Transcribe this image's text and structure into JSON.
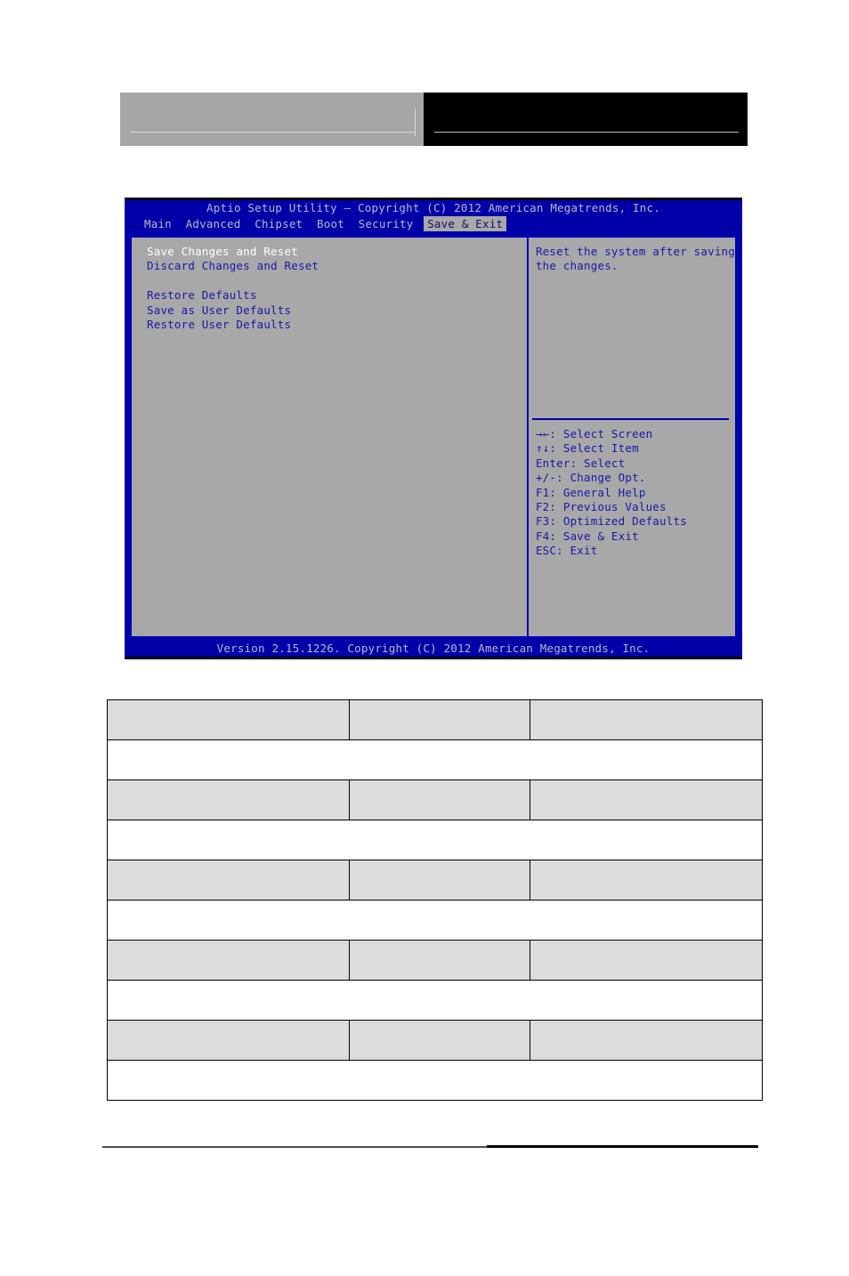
{
  "page": {
    "header_banner": {
      "left_block_color": "#a6a6a6",
      "right_block_color": "#000000"
    }
  },
  "bios": {
    "title": "Aptio Setup Utility – Copyright (C) 2012 American Megatrends, Inc.",
    "tabs": [
      {
        "label": "Main",
        "active": false
      },
      {
        "label": "Advanced",
        "active": false
      },
      {
        "label": "Chipset",
        "active": false
      },
      {
        "label": "Boot",
        "active": false
      },
      {
        "label": "Security",
        "active": false
      },
      {
        "label": "Save & Exit",
        "active": true
      }
    ],
    "menu_items": [
      {
        "label": "Save Changes and Reset",
        "selected": true
      },
      {
        "label": "Discard Changes and Reset",
        "selected": false
      },
      {
        "label": "",
        "selected": false
      },
      {
        "label": "Restore Defaults",
        "selected": false
      },
      {
        "label": "Save as User Defaults",
        "selected": false
      },
      {
        "label": "Restore User Defaults",
        "selected": false
      }
    ],
    "help": {
      "line1": "Reset the system after saving",
      "line2": "the changes."
    },
    "keys": [
      "→←: Select Screen",
      "↑↓: Select Item",
      "Enter: Select",
      "+/-: Change Opt.",
      "F1: General Help",
      "F2: Previous Values",
      "F3: Optimized Defaults",
      "F4: Save & Exit",
      "ESC: Exit"
    ],
    "footer": "Version 2.15.1226. Copyright (C) 2012 American Megatrends, Inc.",
    "colors": {
      "screen_bg": "#0000a8",
      "panel_bg": "#a8a8a8",
      "panel_border": "#0000b4",
      "text": "#1818a8",
      "selected_text": "#ffffff",
      "title_text": "#b8b8c8",
      "tab_active_bg": "#a8a8a8"
    }
  },
  "table": {
    "rows": [
      {
        "type": "head",
        "cells": [
          "",
          "",
          ""
        ]
      },
      {
        "type": "desc",
        "cells": [
          ""
        ]
      },
      {
        "type": "head",
        "cells": [
          "",
          "",
          ""
        ]
      },
      {
        "type": "desc",
        "cells": [
          ""
        ]
      },
      {
        "type": "head",
        "cells": [
          "",
          "",
          ""
        ]
      },
      {
        "type": "desc",
        "cells": [
          ""
        ]
      },
      {
        "type": "head",
        "cells": [
          "",
          "",
          ""
        ]
      },
      {
        "type": "desc",
        "cells": [
          ""
        ]
      },
      {
        "type": "head",
        "cells": [
          "",
          "",
          ""
        ]
      },
      {
        "type": "desc",
        "cells": [
          ""
        ]
      }
    ]
  }
}
